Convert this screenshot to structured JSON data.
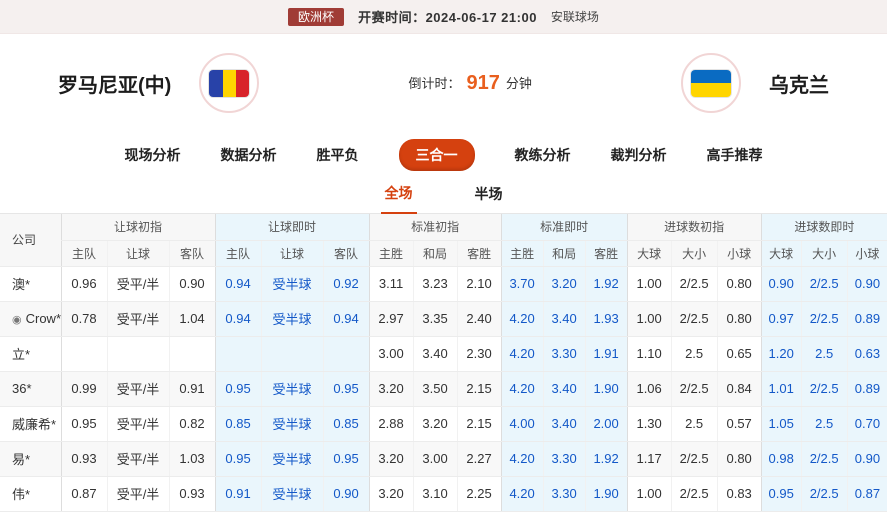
{
  "top_bar": {
    "league": "欧洲杯",
    "kickoff": "开赛时间：2024-06-17 21:00",
    "venue": "安联球场"
  },
  "match": {
    "home_team": "罗马尼亚(中)",
    "away_team": "乌克兰",
    "countdown_prefix": "倒计时：",
    "countdown_value": "917",
    "countdown_suffix": "分钟"
  },
  "nav_tabs": [
    {
      "label": "现场分析",
      "active": false
    },
    {
      "label": "数据分析",
      "active": false
    },
    {
      "label": "胜平负",
      "active": false
    },
    {
      "label": "三合一",
      "active": true
    },
    {
      "label": "教练分析",
      "active": false
    },
    {
      "label": "裁判分析",
      "active": false
    },
    {
      "label": "高手推荐",
      "active": false
    }
  ],
  "sub_tabs": [
    {
      "label": "全场",
      "active": true
    },
    {
      "label": "半场",
      "active": false
    }
  ],
  "odds_table": {
    "company_header": "公司",
    "groups": [
      {
        "label": "让球初指",
        "live": false,
        "columns": [
          "主队",
          "让球",
          "客队"
        ]
      },
      {
        "label": "让球即时",
        "live": true,
        "columns": [
          "主队",
          "让球",
          "客队"
        ]
      },
      {
        "label": "标准初指",
        "live": false,
        "columns": [
          "主胜",
          "和局",
          "客胜"
        ]
      },
      {
        "label": "标准即时",
        "live": true,
        "columns": [
          "主胜",
          "和局",
          "客胜"
        ]
      },
      {
        "label": "进球数初指",
        "live": false,
        "columns": [
          "大球",
          "大小",
          "小球"
        ]
      },
      {
        "label": "进球数即时",
        "live": true,
        "columns": [
          "大球",
          "大小",
          "小球"
        ]
      }
    ],
    "rows": [
      {
        "company": "澳*",
        "icon": false,
        "cells": [
          "0.96",
          "受平/半",
          "0.90",
          "0.94",
          "受半球",
          "0.92",
          "3.11",
          "3.23",
          "2.10",
          "3.70",
          "3.20",
          "1.92",
          "1.00",
          "2/2.5",
          "0.80",
          "0.90",
          "2/2.5",
          "0.90"
        ]
      },
      {
        "company": "Crow*",
        "icon": true,
        "cells": [
          "0.78",
          "受平/半",
          "1.04",
          "0.94",
          "受半球",
          "0.94",
          "2.97",
          "3.35",
          "2.40",
          "4.20",
          "3.40",
          "1.93",
          "1.00",
          "2/2.5",
          "0.80",
          "0.97",
          "2/2.5",
          "0.89"
        ]
      },
      {
        "company": "立*",
        "icon": false,
        "cells": [
          "",
          "",
          "",
          "",
          "",
          "",
          "3.00",
          "3.40",
          "2.30",
          "4.20",
          "3.30",
          "1.91",
          "1.10",
          "2.5",
          "0.65",
          "1.20",
          "2.5",
          "0.63"
        ]
      },
      {
        "company": "36*",
        "icon": false,
        "cells": [
          "0.99",
          "受平/半",
          "0.91",
          "0.95",
          "受半球",
          "0.95",
          "3.20",
          "3.50",
          "2.15",
          "4.20",
          "3.40",
          "1.90",
          "1.06",
          "2/2.5",
          "0.84",
          "1.01",
          "2/2.5",
          "0.89"
        ]
      },
      {
        "company": "威廉希*",
        "icon": false,
        "cells": [
          "0.95",
          "受平/半",
          "0.82",
          "0.85",
          "受半球",
          "0.85",
          "2.88",
          "3.20",
          "2.15",
          "4.00",
          "3.40",
          "2.00",
          "1.30",
          "2.5",
          "0.57",
          "1.05",
          "2.5",
          "0.70"
        ]
      },
      {
        "company": "易*",
        "icon": false,
        "cells": [
          "0.93",
          "受平/半",
          "1.03",
          "0.95",
          "受半球",
          "0.95",
          "3.20",
          "3.00",
          "2.27",
          "4.20",
          "3.30",
          "1.92",
          "1.17",
          "2/2.5",
          "0.80",
          "0.98",
          "2/2.5",
          "0.90"
        ]
      },
      {
        "company": "伟*",
        "icon": false,
        "cells": [
          "0.87",
          "受平/半",
          "0.93",
          "0.91",
          "受半球",
          "0.90",
          "3.20",
          "3.10",
          "2.25",
          "4.20",
          "3.30",
          "1.90",
          "1.00",
          "2/2.5",
          "0.83",
          "0.95",
          "2/2.5",
          "0.87"
        ]
      }
    ]
  },
  "colors": {
    "accent_red": "#d5410f",
    "badge_red": "#a03c36",
    "live_blue": "#1358c8",
    "live_bg": "#eaf6fc",
    "countdown_orange": "#e95f1e"
  }
}
